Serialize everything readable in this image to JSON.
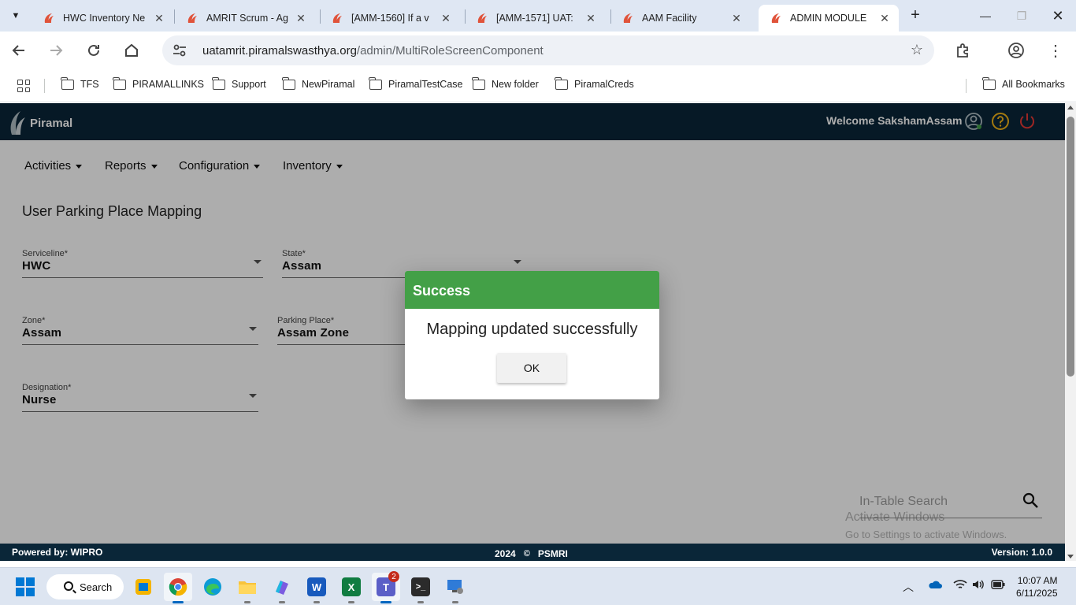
{
  "browser": {
    "tabs": [
      {
        "title": "HWC Inventory Ne",
        "active": false
      },
      {
        "title": "AMRIT Scrum - Ag",
        "active": false
      },
      {
        "title": "[AMM-1560] If a v",
        "active": false
      },
      {
        "title": "[AMM-1571] UAT:",
        "active": false
      },
      {
        "title": "AAM Facility",
        "active": false
      },
      {
        "title": "ADMIN MODULE",
        "active": true
      }
    ],
    "url_host": "uatamrit.piramalswasthya.org",
    "url_path": "/admin/MultiRoleScreenComponent",
    "bookmarks": [
      "TFS",
      "PIRAMALLINKS",
      "Support",
      "NewPiramal",
      "PiramalTestCase",
      "New folder",
      "PiramalCreds"
    ],
    "all_bookmarks": "All Bookmarks"
  },
  "app": {
    "brand": "Piramal",
    "welcome": "Welcome SakshamAssam",
    "menu": [
      "Activities",
      "Reports",
      "Configuration",
      "Inventory"
    ],
    "page_title": "User Parking Place Mapping",
    "fields": {
      "serviceline": {
        "label": "Serviceline*",
        "value": "HWC"
      },
      "state": {
        "label": "State*",
        "value": "Assam"
      },
      "zone": {
        "label": "Zone*",
        "value": "Assam"
      },
      "parking_place": {
        "label": "Parking Place*",
        "value": "Assam Zone"
      },
      "designation": {
        "label": "Designation*",
        "value": "Nurse"
      }
    },
    "search_placeholder": "In-Table Search",
    "watermark_line1": "Activate Windows",
    "watermark_line2": "Go to Settings to activate Windows.",
    "footer": {
      "powered": "Powered by: WIPRO",
      "year": "2024",
      "copyright": "©",
      "org": "PSMRI",
      "version": "Version: 1.0.0"
    }
  },
  "dialog": {
    "title": "Success",
    "message": "Mapping updated successfully",
    "ok_label": "OK",
    "header_color": "#43a047"
  },
  "taskbar": {
    "search_label": "Search",
    "time": "10:07 AM",
    "date": "6/11/2025",
    "teams_badge": "2"
  }
}
